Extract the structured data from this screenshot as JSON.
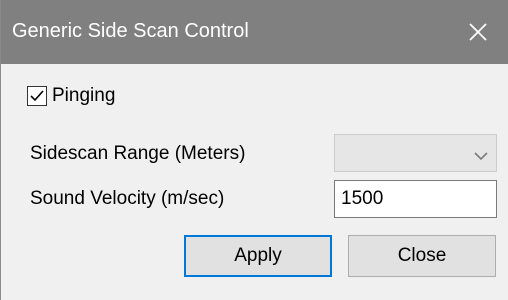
{
  "window": {
    "title": "Generic Side Scan Control",
    "close_icon": "close-icon"
  },
  "pinging": {
    "label": "Pinging",
    "checked": true
  },
  "sidescan_range": {
    "label": "Sidescan Range (Meters)",
    "value": "",
    "enabled": false
  },
  "sound_velocity": {
    "label": "Sound Velocity (m/sec)",
    "value": "1500"
  },
  "buttons": {
    "apply": "Apply",
    "close": "Close"
  },
  "colors": {
    "titlebar": "#808080",
    "dialog_bg": "#f0f0f0",
    "focus_accent": "#0078d7"
  }
}
